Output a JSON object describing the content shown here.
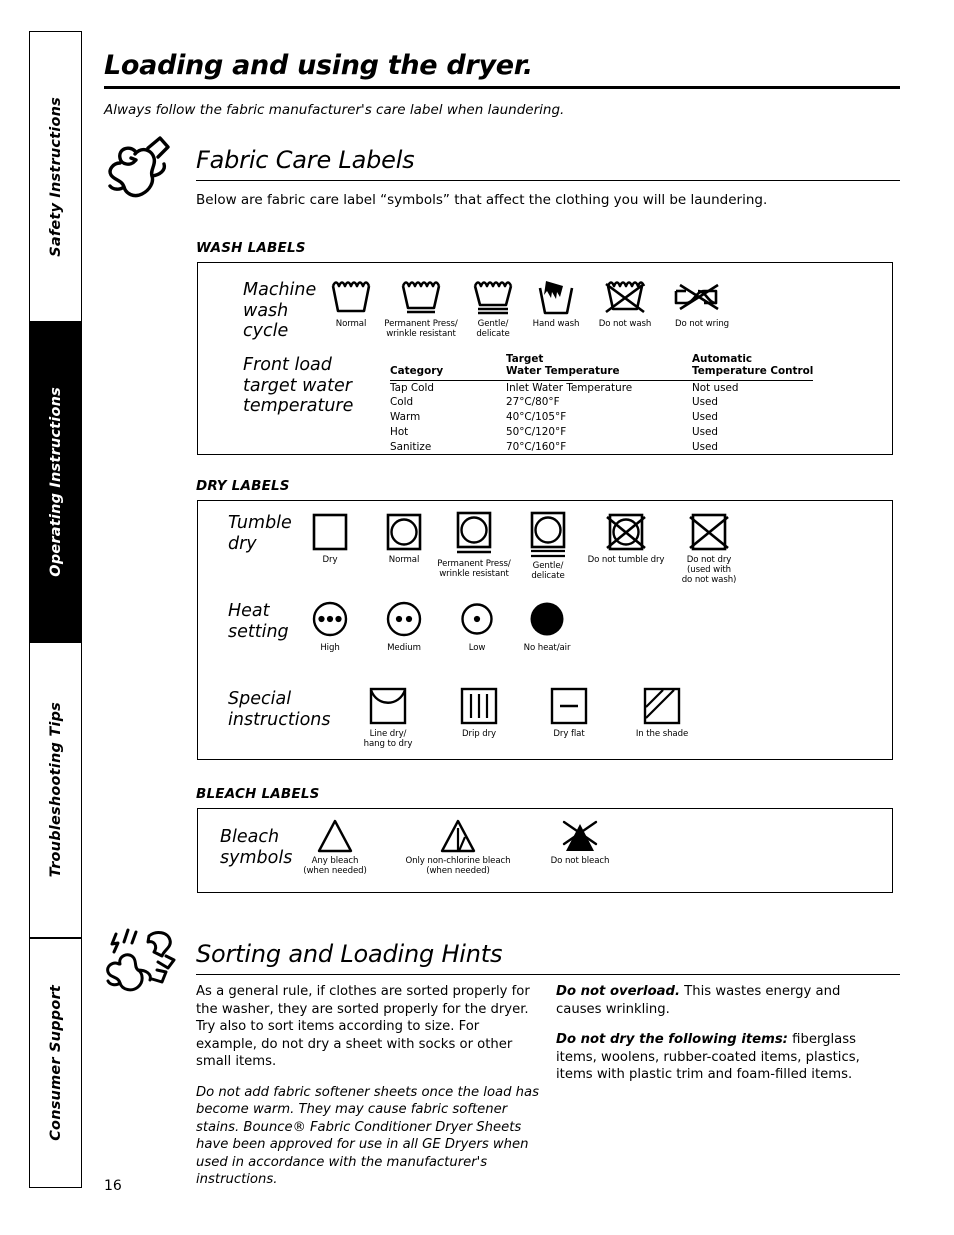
{
  "page_number": "16",
  "sidebar": {
    "tabs": [
      {
        "label": "Safety Instructions",
        "active": false
      },
      {
        "label": "Operating Instructions",
        "active": true
      },
      {
        "label": "Troubleshooting Tips",
        "active": false
      },
      {
        "label": "Consumer Support",
        "active": false
      }
    ]
  },
  "header": {
    "title": "Loading and using the dryer.",
    "intro": "Always follow the fabric manufacturer's care label when laundering."
  },
  "fabric_care": {
    "title": "Fabric Care Labels",
    "subtitle": "Below are fabric care label “symbols” that affect the clothing you will be laundering."
  },
  "wash": {
    "group_label": "WASH LABELS",
    "row1_title": "Machine\nwash\ncycle",
    "symbols": [
      {
        "icon": "washtub-normal-icon",
        "caption": "Normal"
      },
      {
        "icon": "washtub-permanent-press-icon",
        "caption": "Permanent Press/\nwrinkle resistant"
      },
      {
        "icon": "washtub-gentle-icon",
        "caption": "Gentle/\ndelicate"
      },
      {
        "icon": "hand-wash-icon",
        "caption": "Hand wash"
      },
      {
        "icon": "do-not-wash-icon",
        "caption": "Do not wash"
      },
      {
        "icon": "do-not-wring-icon",
        "caption": "Do not wring"
      }
    ],
    "row2_title": "Front load\ntarget water\ntemperature",
    "table": {
      "headers": [
        "Category",
        "Target\nWater Temperature",
        "Automatic\nTemperature Control"
      ],
      "rows": [
        [
          "Tap Cold",
          "Inlet Water Temperature",
          "Not used"
        ],
        [
          "Cold",
          "27°C/80°F",
          "Used"
        ],
        [
          "Warm",
          "40°C/105°F",
          "Used"
        ],
        [
          "Hot",
          "50°C/120°F",
          "Used"
        ],
        [
          "Sanitize",
          "70°C/160°F",
          "Used"
        ]
      ]
    }
  },
  "dry": {
    "group_label": "DRY LABELS",
    "row1_title": "Tumble\ndry",
    "tumble_symbols": [
      {
        "icon": "dry-square-icon",
        "caption": "Dry"
      },
      {
        "icon": "tumble-dry-normal-icon",
        "caption": "Normal"
      },
      {
        "icon": "tumble-dry-permanent-press-icon",
        "caption": "Permanent Press/\nwrinkle resistant"
      },
      {
        "icon": "tumble-dry-gentle-icon",
        "caption": "Gentle/\ndelicate"
      },
      {
        "icon": "do-not-tumble-dry-icon",
        "caption": "Do not tumble dry"
      },
      {
        "icon": "do-not-dry-icon",
        "caption": "Do not dry\n(used with\ndo not wash)"
      }
    ],
    "row2_title": "Heat\nsetting",
    "heat_symbols": [
      {
        "icon": "heat-high-icon",
        "caption": "High"
      },
      {
        "icon": "heat-medium-icon",
        "caption": "Medium"
      },
      {
        "icon": "heat-low-icon",
        "caption": "Low"
      },
      {
        "icon": "no-heat-air-icon",
        "caption": "No heat/air"
      }
    ],
    "row3_title": "Special\ninstructions",
    "special_symbols": [
      {
        "icon": "line-dry-icon",
        "caption": "Line dry/\nhang to dry"
      },
      {
        "icon": "drip-dry-icon",
        "caption": "Drip dry"
      },
      {
        "icon": "dry-flat-icon",
        "caption": "Dry flat"
      },
      {
        "icon": "dry-in-shade-icon",
        "caption": "In the shade"
      }
    ]
  },
  "bleach": {
    "group_label": "BLEACH LABELS",
    "row_title": "Bleach\nsymbols",
    "symbols": [
      {
        "icon": "any-bleach-icon",
        "caption": "Any bleach\n(when needed)"
      },
      {
        "icon": "non-chlorine-bleach-icon",
        "caption": "Only non-chlorine bleach\n(when needed)"
      },
      {
        "icon": "do-not-bleach-icon",
        "caption": "Do not bleach"
      }
    ]
  },
  "sorting": {
    "title": "Sorting and Loading Hints",
    "left_paragraphs": [
      "As a general rule, if clothes are sorted properly for the washer, they are sorted properly for the dryer. Try also to sort items according to size. For example, do not dry a sheet with socks or other small items.",
      "Do not add fabric softener sheets once the load has become warm. They may cause fabric softener stains. Bounce® Fabric Conditioner Dryer Sheets have been approved for use in all GE Dryers when used in accordance with the manufacturer's instructions."
    ],
    "right_items": [
      {
        "lead": "Do not overload.",
        "text": " This wastes energy and causes wrinkling."
      },
      {
        "lead": "Do not dry the following items:",
        "text": " fiberglass items, woolens, rubber-coated items, plastics, items with plastic trim and foam-filled items."
      }
    ]
  }
}
